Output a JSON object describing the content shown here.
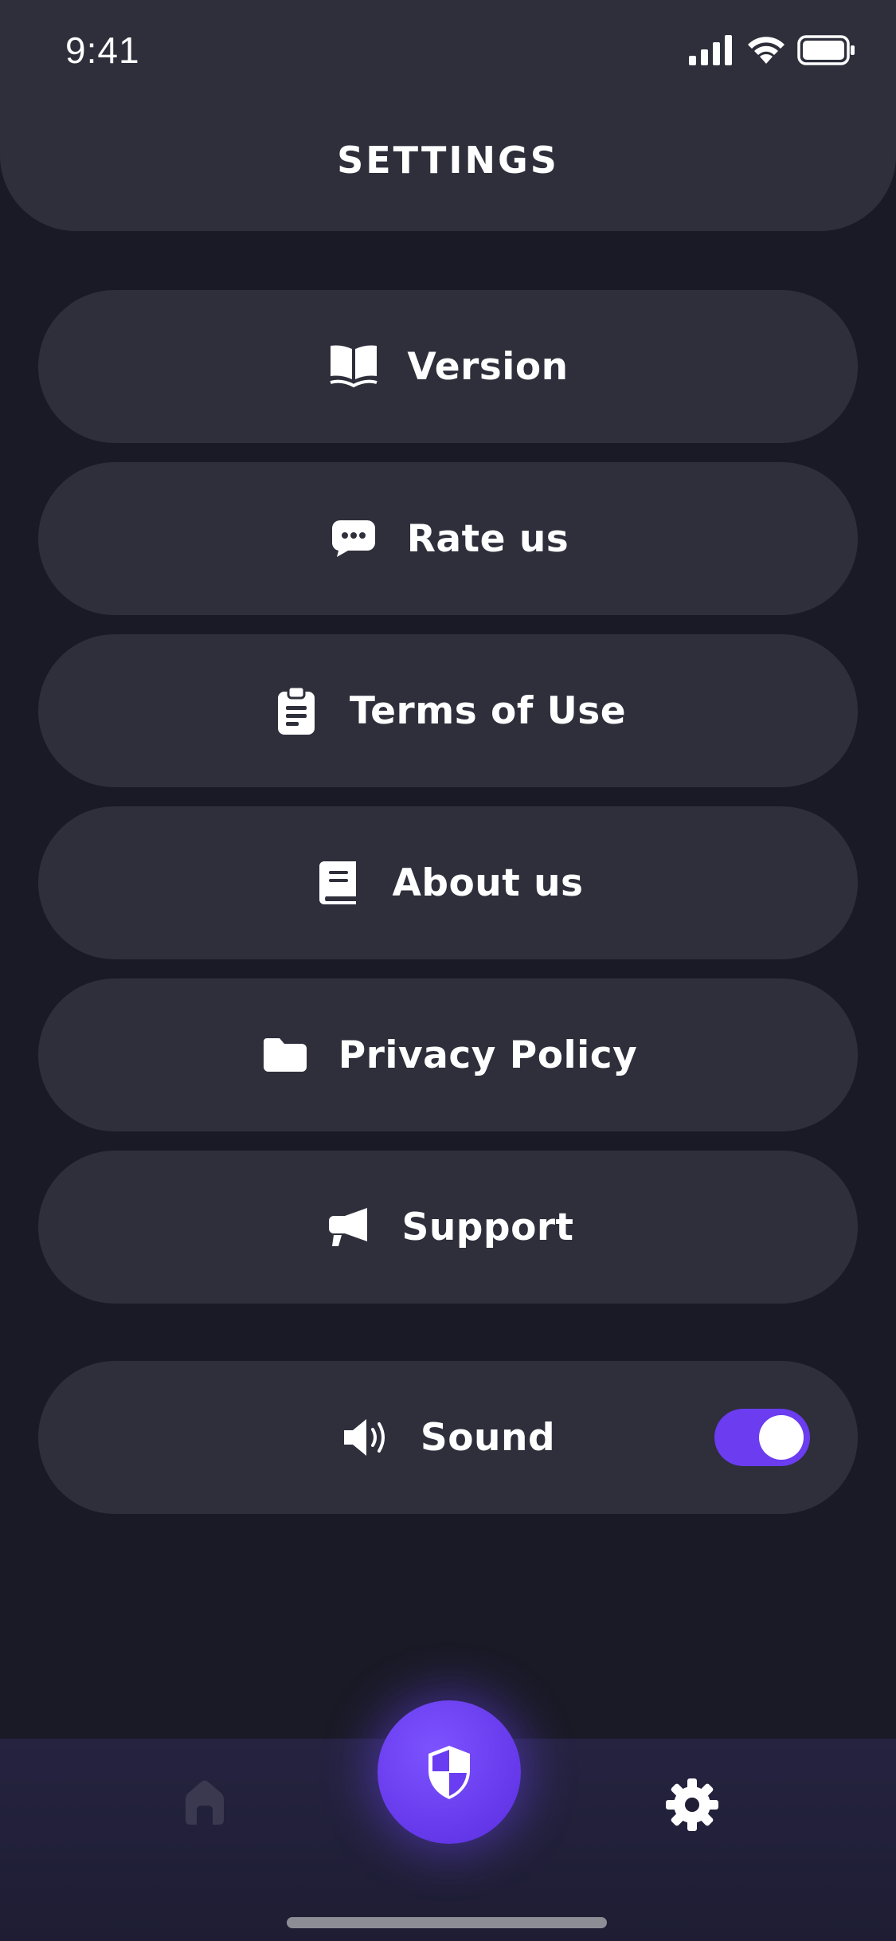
{
  "status_bar": {
    "time": "9:41"
  },
  "header": {
    "title": "SETTINGS"
  },
  "menu": {
    "items": [
      {
        "label": "Version",
        "icon": "book-open-icon"
      },
      {
        "label": "Rate us",
        "icon": "chat-bubble-icon"
      },
      {
        "label": "Terms of Use",
        "icon": "clipboard-icon"
      },
      {
        "label": "About us",
        "icon": "book-icon"
      },
      {
        "label": "Privacy Policy",
        "icon": "folder-icon"
      },
      {
        "label": "Support",
        "icon": "megaphone-icon"
      }
    ],
    "sound": {
      "label": "Sound",
      "icon": "speaker-icon",
      "enabled": true
    }
  },
  "tab_bar": {
    "items": [
      {
        "name": "home",
        "icon": "home-icon",
        "active": false
      },
      {
        "name": "shield",
        "icon": "shield-icon",
        "active": false
      },
      {
        "name": "settings",
        "icon": "gear-icon",
        "active": true
      }
    ]
  },
  "colors": {
    "background": "#1a1a26",
    "card": "#2e2f3b",
    "accent": "#6b3cf0",
    "text": "#ffffff",
    "inactive_icon": "#3a3950"
  }
}
